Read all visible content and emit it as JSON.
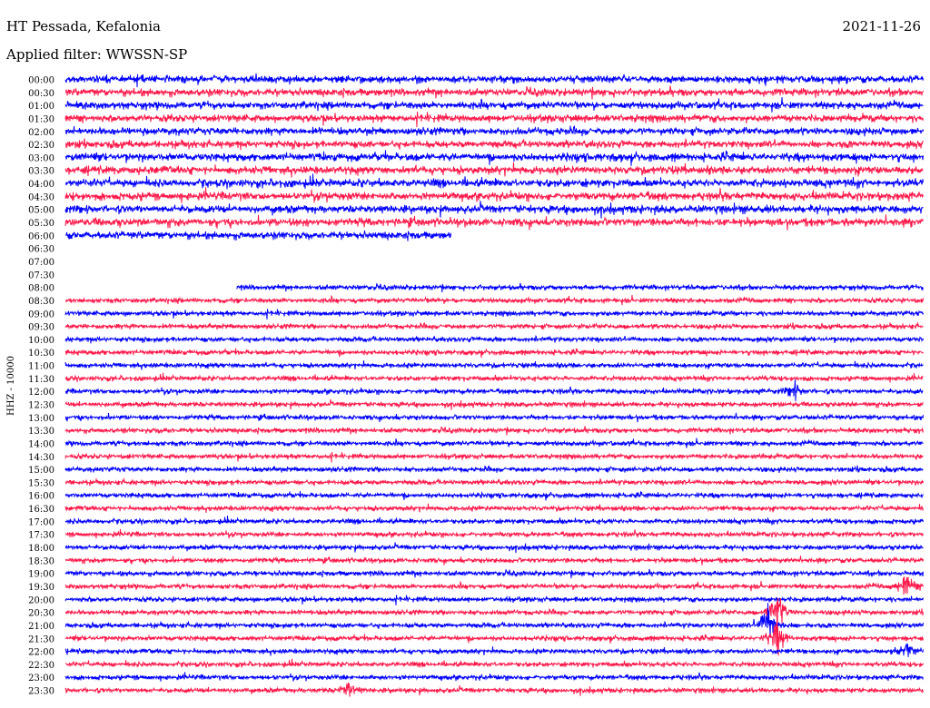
{
  "header": {
    "station": "HT Pessada, Kefalonia",
    "date": "2021-11-26",
    "filter": "Applied filter: WWSSN-SP"
  },
  "chart_data": {
    "type": "line",
    "title": "HT Pessada, Kefalonia",
    "subtitle": "Applied filter: WWSSN-SP",
    "ylabel": "HHZ - 10000",
    "xlabel": "",
    "grid": false,
    "legend": "none",
    "colors": {
      "odd_trace": "#0000ff",
      "even_trace": "#ff1a4b"
    },
    "time_labels": [
      "00:00",
      "00:30",
      "01:00",
      "01:30",
      "02:00",
      "02:30",
      "03:00",
      "03:30",
      "04:00",
      "04:30",
      "05:00",
      "05:30",
      "06:00",
      "06:30",
      "07:00",
      "07:30",
      "08:00",
      "08:30",
      "09:00",
      "09:30",
      "10:00",
      "10:30",
      "11:00",
      "11:30",
      "12:00",
      "12:30",
      "13:00",
      "13:30",
      "14:00",
      "14:30",
      "15:00",
      "15:30",
      "16:00",
      "16:30",
      "17:00",
      "17:30",
      "18:00",
      "18:30",
      "19:00",
      "19:30",
      "20:00",
      "20:30",
      "21:00",
      "21:30",
      "22:00",
      "22:30",
      "23:00",
      "23:30"
    ],
    "x_range_minutes": [
      0,
      30
    ],
    "series": [
      {
        "time": "00:00",
        "start": 0.0,
        "end": 1.0,
        "amplitude": 0.9
      },
      {
        "time": "00:30",
        "start": 0.0,
        "end": 1.0,
        "amplitude": 0.9
      },
      {
        "time": "01:00",
        "start": 0.0,
        "end": 1.0,
        "amplitude": 0.9
      },
      {
        "time": "01:30",
        "start": 0.0,
        "end": 1.0,
        "amplitude": 0.9
      },
      {
        "time": "02:00",
        "start": 0.0,
        "end": 1.0,
        "amplitude": 0.9
      },
      {
        "time": "02:30",
        "start": 0.0,
        "end": 1.0,
        "amplitude": 0.9
      },
      {
        "time": "03:00",
        "start": 0.0,
        "end": 1.0,
        "amplitude": 1.0
      },
      {
        "time": "03:30",
        "start": 0.0,
        "end": 1.0,
        "amplitude": 1.0
      },
      {
        "time": "04:00",
        "start": 0.0,
        "end": 1.0,
        "amplitude": 1.0
      },
      {
        "time": "04:30",
        "start": 0.0,
        "end": 1.0,
        "amplitude": 1.0
      },
      {
        "time": "05:00",
        "start": 0.0,
        "end": 1.0,
        "amplitude": 1.0
      },
      {
        "time": "05:30",
        "start": 0.0,
        "end": 1.0,
        "amplitude": 1.0
      },
      {
        "time": "06:00",
        "start": 0.0,
        "end": 0.45,
        "amplitude": 0.9
      },
      {
        "time": "06:30",
        "start": 0.0,
        "end": 0.0,
        "amplitude": 0.0
      },
      {
        "time": "07:00",
        "start": 0.0,
        "end": 0.0,
        "amplitude": 0.0
      },
      {
        "time": "07:30",
        "start": 0.0,
        "end": 0.0,
        "amplitude": 0.0
      },
      {
        "time": "08:00",
        "start": 0.2,
        "end": 1.0,
        "amplitude": 0.6
      },
      {
        "time": "08:30",
        "start": 0.0,
        "end": 1.0,
        "amplitude": 0.6
      },
      {
        "time": "09:00",
        "start": 0.0,
        "end": 1.0,
        "amplitude": 0.6
      },
      {
        "time": "09:30",
        "start": 0.0,
        "end": 1.0,
        "amplitude": 0.6
      },
      {
        "time": "10:00",
        "start": 0.0,
        "end": 1.0,
        "amplitude": 0.6
      },
      {
        "time": "10:30",
        "start": 0.0,
        "end": 1.0,
        "amplitude": 0.6
      },
      {
        "time": "11:00",
        "start": 0.0,
        "end": 1.0,
        "amplitude": 0.6
      },
      {
        "time": "11:30",
        "start": 0.0,
        "end": 1.0,
        "amplitude": 0.6
      },
      {
        "time": "12:00",
        "start": 0.0,
        "end": 1.0,
        "amplitude": 0.6
      },
      {
        "time": "12:30",
        "start": 0.0,
        "end": 1.0,
        "amplitude": 0.6
      },
      {
        "time": "13:00",
        "start": 0.0,
        "end": 1.0,
        "amplitude": 0.6
      },
      {
        "time": "13:30",
        "start": 0.0,
        "end": 1.0,
        "amplitude": 0.6
      },
      {
        "time": "14:00",
        "start": 0.0,
        "end": 1.0,
        "amplitude": 0.6
      },
      {
        "time": "14:30",
        "start": 0.0,
        "end": 1.0,
        "amplitude": 0.6
      },
      {
        "time": "15:00",
        "start": 0.0,
        "end": 1.0,
        "amplitude": 0.6
      },
      {
        "time": "15:30",
        "start": 0.0,
        "end": 1.0,
        "amplitude": 0.6
      },
      {
        "time": "16:00",
        "start": 0.0,
        "end": 1.0,
        "amplitude": 0.6
      },
      {
        "time": "16:30",
        "start": 0.0,
        "end": 1.0,
        "amplitude": 0.6
      },
      {
        "time": "17:00",
        "start": 0.0,
        "end": 1.0,
        "amplitude": 0.6
      },
      {
        "time": "17:30",
        "start": 0.0,
        "end": 1.0,
        "amplitude": 0.6
      },
      {
        "time": "18:00",
        "start": 0.0,
        "end": 1.0,
        "amplitude": 0.6
      },
      {
        "time": "18:30",
        "start": 0.0,
        "end": 1.0,
        "amplitude": 0.6
      },
      {
        "time": "19:00",
        "start": 0.0,
        "end": 1.0,
        "amplitude": 0.6
      },
      {
        "time": "19:30",
        "start": 0.0,
        "end": 1.0,
        "amplitude": 0.6
      },
      {
        "time": "20:00",
        "start": 0.0,
        "end": 1.0,
        "amplitude": 0.6
      },
      {
        "time": "20:30",
        "start": 0.0,
        "end": 1.0,
        "amplitude": 0.6
      },
      {
        "time": "21:00",
        "start": 0.0,
        "end": 1.0,
        "amplitude": 0.6
      },
      {
        "time": "21:30",
        "start": 0.0,
        "end": 1.0,
        "amplitude": 0.6
      },
      {
        "time": "22:00",
        "start": 0.0,
        "end": 1.0,
        "amplitude": 0.6
      },
      {
        "time": "22:30",
        "start": 0.0,
        "end": 1.0,
        "amplitude": 0.6
      },
      {
        "time": "23:00",
        "start": 0.0,
        "end": 1.0,
        "amplitude": 0.6
      },
      {
        "time": "23:30",
        "start": 0.0,
        "end": 1.0,
        "amplitude": 0.6
      }
    ],
    "events": [
      {
        "time": "20:30",
        "position": 0.83,
        "amplitude": 5.0
      },
      {
        "time": "21:00",
        "position": 0.82,
        "amplitude": 6.0
      },
      {
        "time": "21:30",
        "position": 0.83,
        "amplitude": 4.0
      },
      {
        "time": "22:00",
        "position": 0.98,
        "amplitude": 3.0
      },
      {
        "time": "19:30",
        "position": 0.98,
        "amplitude": 3.0
      },
      {
        "time": "12:00",
        "position": 0.85,
        "amplitude": 2.0
      },
      {
        "time": "23:30",
        "position": 0.33,
        "amplitude": 2.0
      }
    ]
  }
}
